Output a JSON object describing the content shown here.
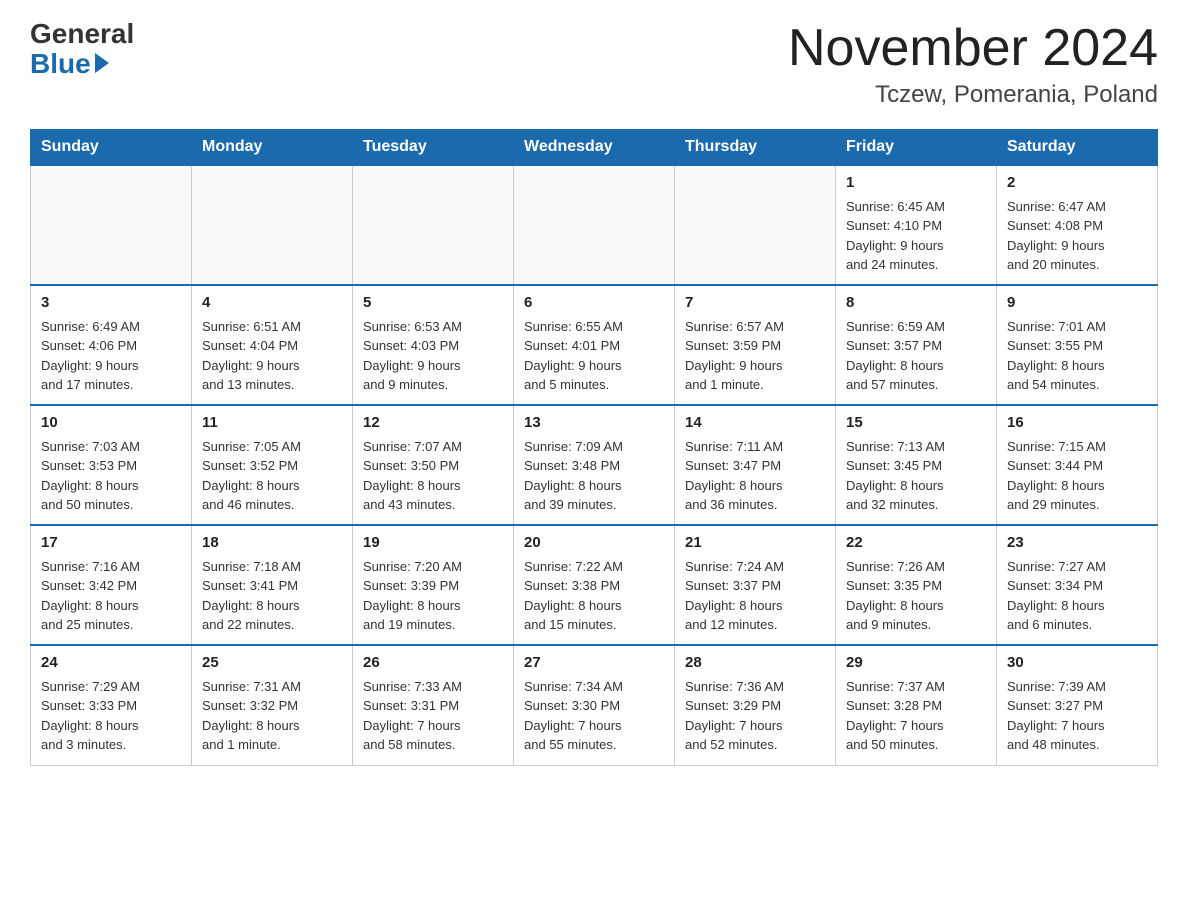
{
  "logo": {
    "general": "General",
    "blue": "Blue"
  },
  "title": "November 2024",
  "location": "Tczew, Pomerania, Poland",
  "days_of_week": [
    "Sunday",
    "Monday",
    "Tuesday",
    "Wednesday",
    "Thursday",
    "Friday",
    "Saturday"
  ],
  "weeks": [
    [
      {
        "day": "",
        "info": ""
      },
      {
        "day": "",
        "info": ""
      },
      {
        "day": "",
        "info": ""
      },
      {
        "day": "",
        "info": ""
      },
      {
        "day": "",
        "info": ""
      },
      {
        "day": "1",
        "info": "Sunrise: 6:45 AM\nSunset: 4:10 PM\nDaylight: 9 hours\nand 24 minutes."
      },
      {
        "day": "2",
        "info": "Sunrise: 6:47 AM\nSunset: 4:08 PM\nDaylight: 9 hours\nand 20 minutes."
      }
    ],
    [
      {
        "day": "3",
        "info": "Sunrise: 6:49 AM\nSunset: 4:06 PM\nDaylight: 9 hours\nand 17 minutes."
      },
      {
        "day": "4",
        "info": "Sunrise: 6:51 AM\nSunset: 4:04 PM\nDaylight: 9 hours\nand 13 minutes."
      },
      {
        "day": "5",
        "info": "Sunrise: 6:53 AM\nSunset: 4:03 PM\nDaylight: 9 hours\nand 9 minutes."
      },
      {
        "day": "6",
        "info": "Sunrise: 6:55 AM\nSunset: 4:01 PM\nDaylight: 9 hours\nand 5 minutes."
      },
      {
        "day": "7",
        "info": "Sunrise: 6:57 AM\nSunset: 3:59 PM\nDaylight: 9 hours\nand 1 minute."
      },
      {
        "day": "8",
        "info": "Sunrise: 6:59 AM\nSunset: 3:57 PM\nDaylight: 8 hours\nand 57 minutes."
      },
      {
        "day": "9",
        "info": "Sunrise: 7:01 AM\nSunset: 3:55 PM\nDaylight: 8 hours\nand 54 minutes."
      }
    ],
    [
      {
        "day": "10",
        "info": "Sunrise: 7:03 AM\nSunset: 3:53 PM\nDaylight: 8 hours\nand 50 minutes."
      },
      {
        "day": "11",
        "info": "Sunrise: 7:05 AM\nSunset: 3:52 PM\nDaylight: 8 hours\nand 46 minutes."
      },
      {
        "day": "12",
        "info": "Sunrise: 7:07 AM\nSunset: 3:50 PM\nDaylight: 8 hours\nand 43 minutes."
      },
      {
        "day": "13",
        "info": "Sunrise: 7:09 AM\nSunset: 3:48 PM\nDaylight: 8 hours\nand 39 minutes."
      },
      {
        "day": "14",
        "info": "Sunrise: 7:11 AM\nSunset: 3:47 PM\nDaylight: 8 hours\nand 36 minutes."
      },
      {
        "day": "15",
        "info": "Sunrise: 7:13 AM\nSunset: 3:45 PM\nDaylight: 8 hours\nand 32 minutes."
      },
      {
        "day": "16",
        "info": "Sunrise: 7:15 AM\nSunset: 3:44 PM\nDaylight: 8 hours\nand 29 minutes."
      }
    ],
    [
      {
        "day": "17",
        "info": "Sunrise: 7:16 AM\nSunset: 3:42 PM\nDaylight: 8 hours\nand 25 minutes."
      },
      {
        "day": "18",
        "info": "Sunrise: 7:18 AM\nSunset: 3:41 PM\nDaylight: 8 hours\nand 22 minutes."
      },
      {
        "day": "19",
        "info": "Sunrise: 7:20 AM\nSunset: 3:39 PM\nDaylight: 8 hours\nand 19 minutes."
      },
      {
        "day": "20",
        "info": "Sunrise: 7:22 AM\nSunset: 3:38 PM\nDaylight: 8 hours\nand 15 minutes."
      },
      {
        "day": "21",
        "info": "Sunrise: 7:24 AM\nSunset: 3:37 PM\nDaylight: 8 hours\nand 12 minutes."
      },
      {
        "day": "22",
        "info": "Sunrise: 7:26 AM\nSunset: 3:35 PM\nDaylight: 8 hours\nand 9 minutes."
      },
      {
        "day": "23",
        "info": "Sunrise: 7:27 AM\nSunset: 3:34 PM\nDaylight: 8 hours\nand 6 minutes."
      }
    ],
    [
      {
        "day": "24",
        "info": "Sunrise: 7:29 AM\nSunset: 3:33 PM\nDaylight: 8 hours\nand 3 minutes."
      },
      {
        "day": "25",
        "info": "Sunrise: 7:31 AM\nSunset: 3:32 PM\nDaylight: 8 hours\nand 1 minute."
      },
      {
        "day": "26",
        "info": "Sunrise: 7:33 AM\nSunset: 3:31 PM\nDaylight: 7 hours\nand 58 minutes."
      },
      {
        "day": "27",
        "info": "Sunrise: 7:34 AM\nSunset: 3:30 PM\nDaylight: 7 hours\nand 55 minutes."
      },
      {
        "day": "28",
        "info": "Sunrise: 7:36 AM\nSunset: 3:29 PM\nDaylight: 7 hours\nand 52 minutes."
      },
      {
        "day": "29",
        "info": "Sunrise: 7:37 AM\nSunset: 3:28 PM\nDaylight: 7 hours\nand 50 minutes."
      },
      {
        "day": "30",
        "info": "Sunrise: 7:39 AM\nSunset: 3:27 PM\nDaylight: 7 hours\nand 48 minutes."
      }
    ]
  ]
}
